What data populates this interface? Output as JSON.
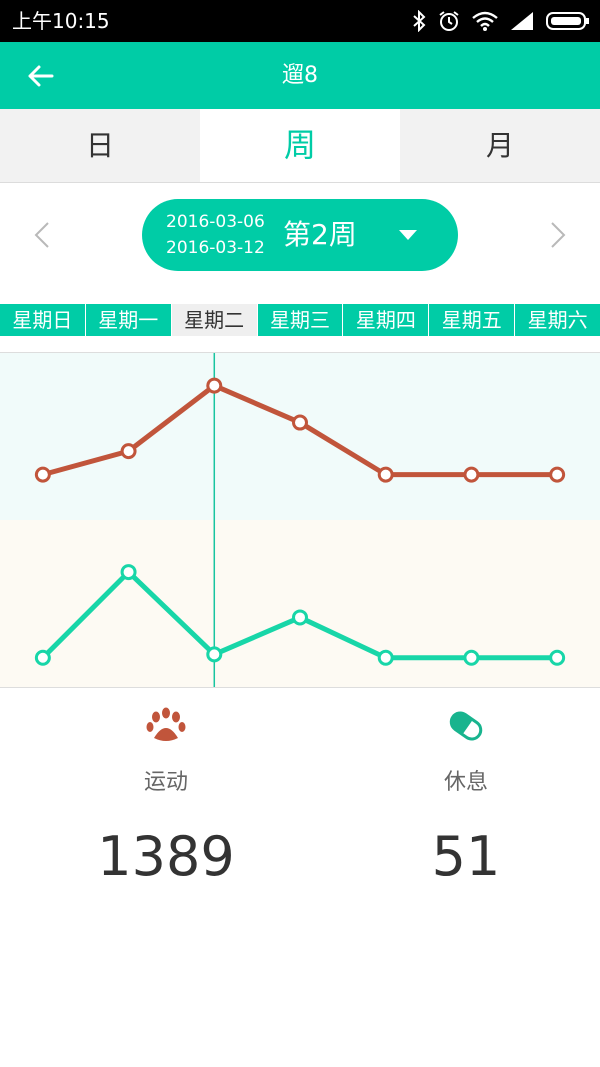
{
  "statusbar": {
    "time": "上午10:15"
  },
  "appbar": {
    "title": "遛8",
    "back_icon": "arrow-left-icon"
  },
  "tabs": [
    {
      "label": "日",
      "active": false
    },
    {
      "label": "周",
      "active": true
    },
    {
      "label": "月",
      "active": false
    }
  ],
  "week": {
    "start": "2016-03-06",
    "end": "2016-03-12",
    "label": "第2周"
  },
  "days": [
    "星期日",
    "星期一",
    "星期二",
    "星期三",
    "星期四",
    "星期五",
    "星期六"
  ],
  "selected_day_index": 2,
  "colors": {
    "accent": "#00cca6",
    "activity": "#c1553b",
    "rest": "#18d6a8"
  },
  "chart_data": {
    "type": "line",
    "categories": [
      "星期日",
      "星期一",
      "星期二",
      "星期三",
      "星期四",
      "星期五",
      "星期六"
    ],
    "series": [
      {
        "values": [
          0.27,
          0.41,
          0.8,
          0.58,
          0.27,
          0.27,
          0.27
        ]
      },
      {
        "values": [
          0.18,
          0.69,
          0.2,
          0.42,
          0.18,
          0.18,
          0.18
        ]
      }
    ]
  },
  "stats": {
    "activity": {
      "label": "运动",
      "value": "1389"
    },
    "rest": {
      "label": "休息",
      "value": "51"
    }
  }
}
